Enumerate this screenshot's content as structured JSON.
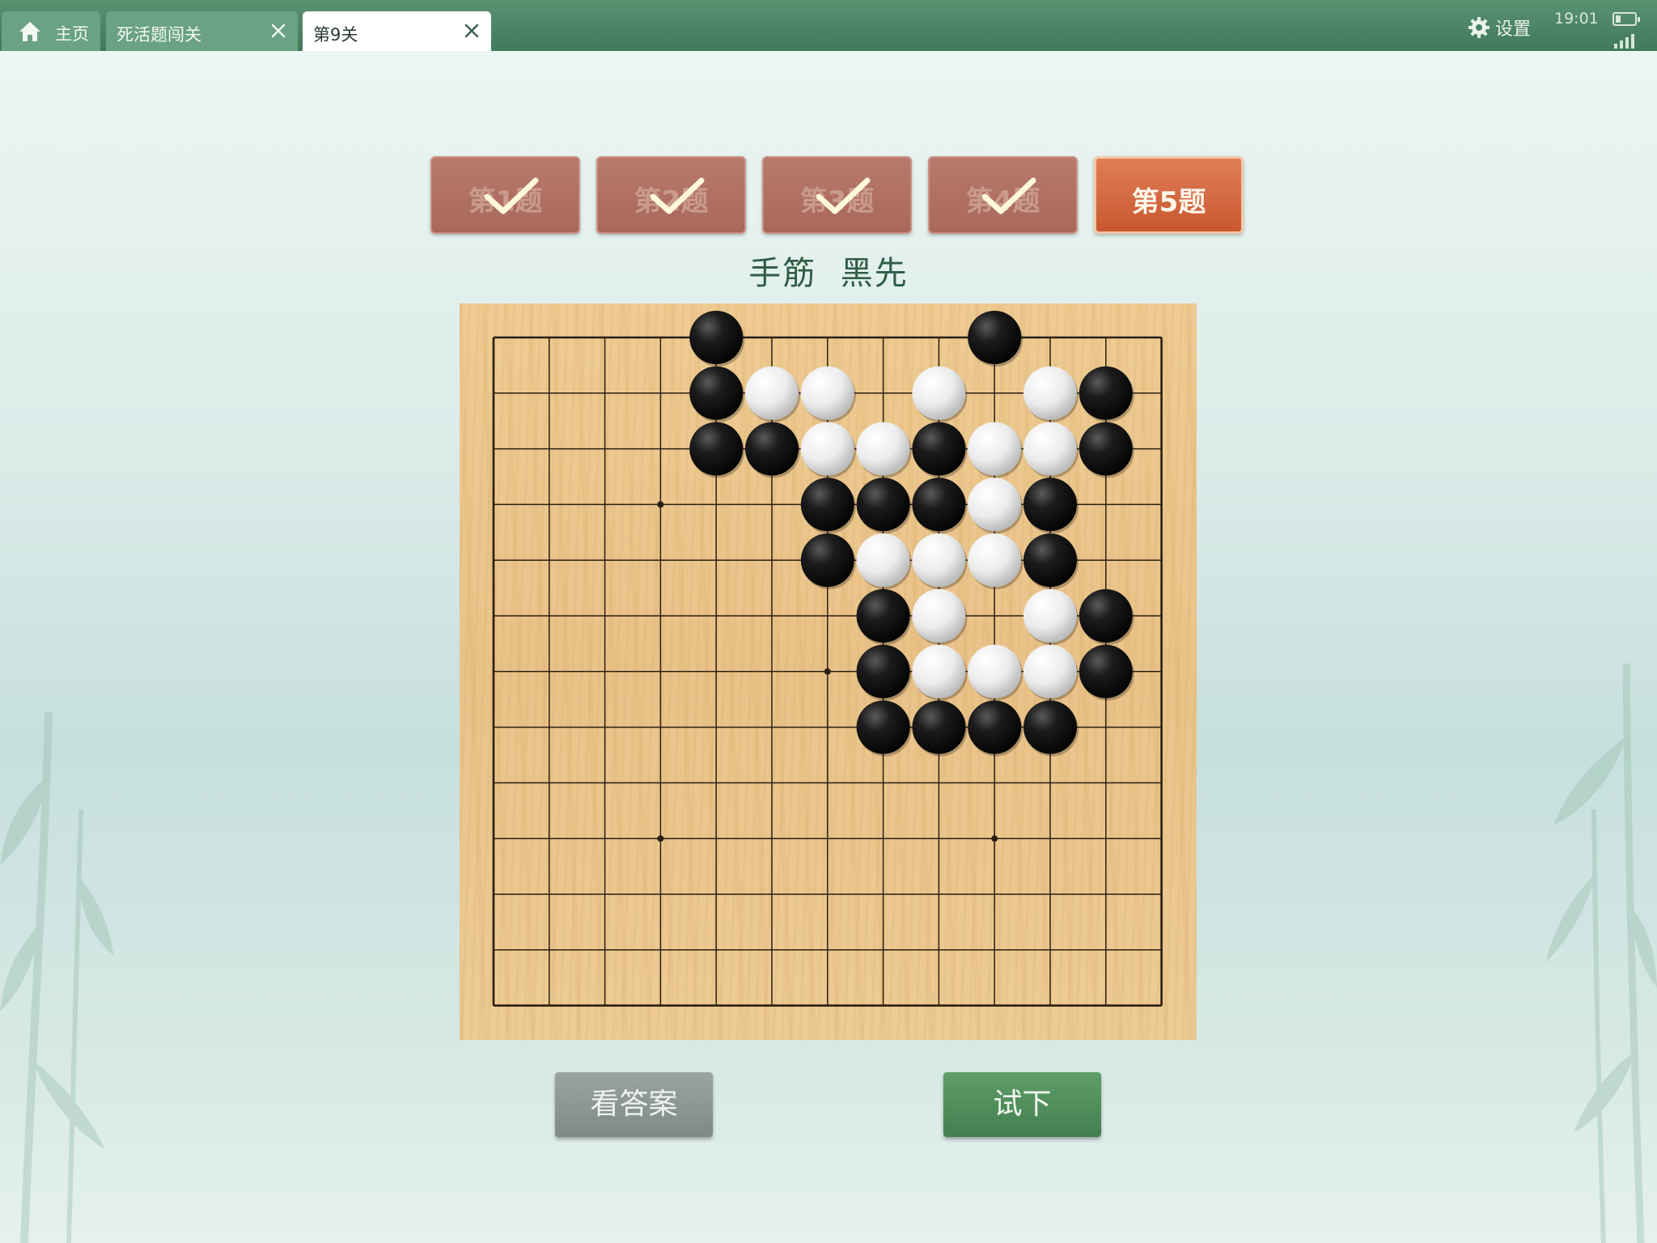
{
  "tabs": [
    {
      "label": "主页",
      "icon": "home-icon",
      "active": false,
      "closable": false
    },
    {
      "label": "死活题闯关",
      "active": false,
      "closable": true
    },
    {
      "label": "第9关",
      "active": true,
      "closable": true
    }
  ],
  "status": {
    "settings_label": "设置",
    "time": "19:01"
  },
  "problems": [
    {
      "label": "第1题",
      "solved": true
    },
    {
      "label": "第2题",
      "solved": true
    },
    {
      "label": "第3题",
      "solved": true
    },
    {
      "label": "第4题",
      "solved": true
    },
    {
      "label": "第5题",
      "solved": false,
      "current": true
    }
  ],
  "caption": "手筋  黑先",
  "board": {
    "size": 13,
    "star_points": [
      [
        3,
        3
      ],
      [
        3,
        9
      ],
      [
        9,
        3
      ],
      [
        9,
        9
      ],
      [
        6,
        6
      ]
    ],
    "stones": [
      {
        "color": "black",
        "col": 4,
        "row": 0
      },
      {
        "color": "black",
        "col": 9,
        "row": 0
      },
      {
        "color": "black",
        "col": 4,
        "row": 1
      },
      {
        "color": "white",
        "col": 5,
        "row": 1
      },
      {
        "color": "white",
        "col": 6,
        "row": 1
      },
      {
        "color": "white",
        "col": 8,
        "row": 1
      },
      {
        "color": "white",
        "col": 10,
        "row": 1
      },
      {
        "color": "black",
        "col": 11,
        "row": 1
      },
      {
        "color": "black",
        "col": 4,
        "row": 2
      },
      {
        "color": "black",
        "col": 5,
        "row": 2
      },
      {
        "color": "white",
        "col": 6,
        "row": 2
      },
      {
        "color": "white",
        "col": 7,
        "row": 2
      },
      {
        "color": "black",
        "col": 8,
        "row": 2
      },
      {
        "color": "white",
        "col": 9,
        "row": 2
      },
      {
        "color": "white",
        "col": 10,
        "row": 2
      },
      {
        "color": "black",
        "col": 11,
        "row": 2
      },
      {
        "color": "black",
        "col": 6,
        "row": 3
      },
      {
        "color": "black",
        "col": 7,
        "row": 3
      },
      {
        "color": "black",
        "col": 8,
        "row": 3
      },
      {
        "color": "white",
        "col": 9,
        "row": 3
      },
      {
        "color": "black",
        "col": 10,
        "row": 3
      },
      {
        "color": "black",
        "col": 6,
        "row": 4
      },
      {
        "color": "white",
        "col": 7,
        "row": 4
      },
      {
        "color": "white",
        "col": 8,
        "row": 4
      },
      {
        "color": "white",
        "col": 9,
        "row": 4
      },
      {
        "color": "black",
        "col": 10,
        "row": 4
      },
      {
        "color": "black",
        "col": 7,
        "row": 5
      },
      {
        "color": "white",
        "col": 8,
        "row": 5
      },
      {
        "color": "white",
        "col": 10,
        "row": 5
      },
      {
        "color": "black",
        "col": 11,
        "row": 5
      },
      {
        "color": "black",
        "col": 7,
        "row": 6
      },
      {
        "color": "white",
        "col": 8,
        "row": 6
      },
      {
        "color": "white",
        "col": 9,
        "row": 6
      },
      {
        "color": "white",
        "col": 10,
        "row": 6
      },
      {
        "color": "black",
        "col": 11,
        "row": 6
      },
      {
        "color": "black",
        "col": 7,
        "row": 7
      },
      {
        "color": "black",
        "col": 8,
        "row": 7
      },
      {
        "color": "black",
        "col": 9,
        "row": 7
      },
      {
        "color": "black",
        "col": 10,
        "row": 7
      }
    ]
  },
  "buttons": {
    "answer_label": "看答案",
    "try_label": "试下"
  }
}
